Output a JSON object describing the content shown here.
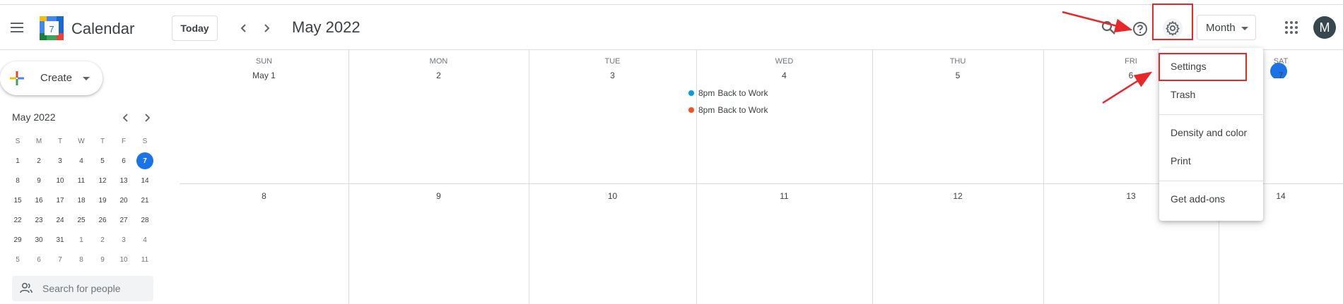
{
  "header": {
    "app_title": "Calendar",
    "logo_day": "7",
    "today_label": "Today",
    "month_title": "May 2022",
    "view_select": "Month",
    "avatar_initial": "M"
  },
  "sidebar": {
    "create_label": "Create",
    "mini_calendar": {
      "title": "May 2022",
      "dow": [
        "S",
        "M",
        "T",
        "W",
        "T",
        "F",
        "S"
      ],
      "weeks": [
        [
          "1",
          "2",
          "3",
          "4",
          "5",
          "6",
          "7"
        ],
        [
          "8",
          "9",
          "10",
          "11",
          "12",
          "13",
          "14"
        ],
        [
          "15",
          "16",
          "17",
          "18",
          "19",
          "20",
          "21"
        ],
        [
          "22",
          "23",
          "24",
          "25",
          "26",
          "27",
          "28"
        ],
        [
          "29",
          "30",
          "31",
          "1",
          "2",
          "3",
          "4"
        ],
        [
          "5",
          "6",
          "7",
          "8",
          "9",
          "10",
          "11"
        ]
      ],
      "selected_day": "7"
    },
    "people_search_placeholder": "Search for people"
  },
  "month_grid": {
    "dow": [
      "SUN",
      "MON",
      "TUE",
      "WED",
      "THU",
      "FRI",
      "SAT"
    ],
    "week1": [
      "May 1",
      "2",
      "3",
      "4",
      "5",
      "6",
      "7"
    ],
    "week2": [
      "8",
      "9",
      "10",
      "11",
      "12",
      "13",
      "14"
    ],
    "events": [
      {
        "time": "8pm",
        "title": "Back to Work",
        "color": "#039be5"
      },
      {
        "time": "8pm",
        "title": "Back to Work",
        "color": "#f4511e"
      }
    ]
  },
  "settings_menu": {
    "items": [
      "Settings",
      "Trash",
      "Density and color",
      "Print",
      "Get add-ons"
    ]
  },
  "colors": {
    "accent_blue": "#1a73e8",
    "annotation_red": "#e8272b"
  },
  "icons": [
    "hamburger-icon",
    "search-icon",
    "help-icon",
    "gear-icon",
    "apps-icon",
    "chevron-left-icon",
    "chevron-right-icon",
    "people-icon"
  ]
}
